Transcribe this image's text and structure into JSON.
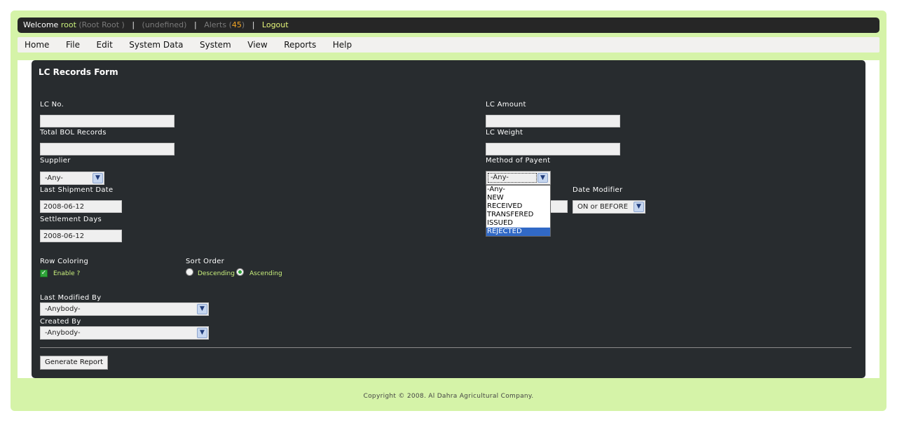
{
  "topbar": {
    "welcome": "Welcome",
    "username": "root",
    "fullname": "(Root Root )",
    "separator": "|",
    "undefined_text": "(undefined)",
    "alerts_label": "Alerts (",
    "alerts_count": "45",
    "alerts_close": ")",
    "logout": "Logout"
  },
  "menu": [
    "Home",
    "File",
    "Edit",
    "System Data",
    "System",
    "View",
    "Reports",
    "Help"
  ],
  "form": {
    "title": "LC Records Form",
    "lc_no_label": "LC No.",
    "lc_no_value": "",
    "total_bol_label": "Total BOL Records",
    "total_bol_value": "",
    "supplier_label": "Supplier",
    "supplier_value": "-Any-",
    "last_shipment_label": "Last Shipment Date",
    "last_shipment_value": "2008-06-12",
    "settlement_label": "Settlement Days",
    "settlement_value": "2008-06-12",
    "lc_amount_label": "LC Amount",
    "lc_amount_value": "",
    "lc_weight_label": "LC Weight",
    "lc_weight_value": "",
    "method_label": "Method of Payent",
    "method_value": "-Any-",
    "method_options": [
      "-Any-",
      "NEW",
      "RECEIVED",
      "TRANSFERED",
      "ISSUED",
      "REJECTED"
    ],
    "method_highlighted": "REJECTED",
    "date_modifier_label": "Date Modifier",
    "date_modifier_value": "ON or BEFORE",
    "row_coloring_label": "Row Coloring",
    "enable_label": "Enable ?",
    "sort_order_label": "Sort Order",
    "descending_label": "Descending",
    "ascending_label": "Ascending",
    "sort_selected": "Ascending",
    "last_modified_label": "Last Modified By",
    "last_modified_value": "-Anybody-",
    "created_by_label": "Created By",
    "created_by_value": "-Anybody-",
    "generate_button": "Generate Report"
  },
  "footer": "Copyright © 2008. Al Dahra Agricultural Company.",
  "icons": {
    "select_arrow": "chevron-down-icon",
    "checkbox_check": "check-icon"
  },
  "colors": {
    "frame_bg": "#d5f3a8",
    "panel_bg": "#282c2f",
    "topbar_bg": "#262626",
    "accent_green": "#c9f07c",
    "alert_orange": "#f5a623",
    "highlight_blue": "#3169c6"
  }
}
